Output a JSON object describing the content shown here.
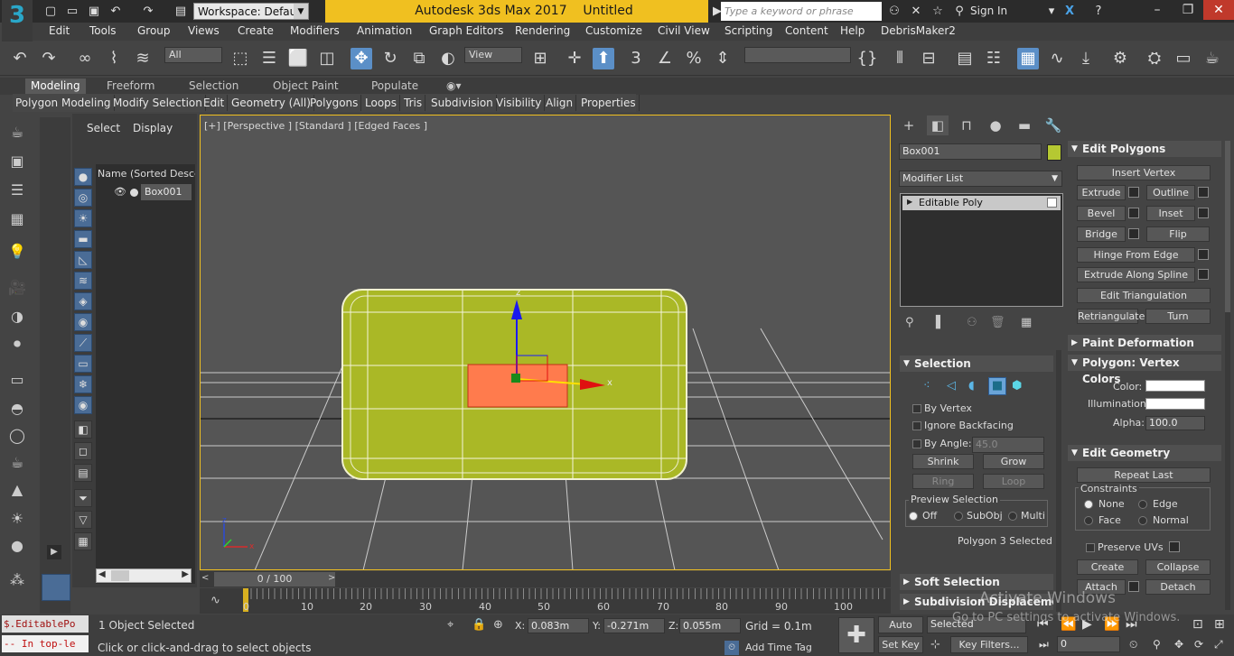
{
  "title_bar": {
    "logo": "3",
    "workspace": "Workspace: Default",
    "app_title": "Autodesk 3ds Max 2017",
    "doc_title": "Untitled",
    "search_placeholder": "Type a keyword or phrase",
    "sign_in": "Sign In"
  },
  "menu": [
    "Edit",
    "Tools",
    "Group",
    "Views",
    "Create",
    "Modifiers",
    "Animation",
    "Graph Editors",
    "Rendering",
    "Customize",
    "Civil View",
    "Scripting",
    "Content",
    "Help",
    "DebrisMaker2"
  ],
  "toolbar": {
    "filter_all": "All",
    "ref_coord": "View"
  },
  "ribbon": {
    "tabs": [
      "Modeling",
      "Freeform",
      "Selection",
      "Object Paint",
      "Populate"
    ],
    "buttons": [
      "Polygon Modeling",
      "Modify Selection",
      "Edit",
      "Geometry (All)",
      "Polygons",
      "Loops",
      "Tris",
      "Subdivision",
      "Visibility",
      "Align",
      "Properties"
    ]
  },
  "explorer": {
    "tab_select": "Select",
    "tab_display": "Display",
    "column_header": "Name (Sorted Descen",
    "item": "Box001"
  },
  "viewport": {
    "label": "[+] [Perspective ] [Standard ] [Edged Faces ]",
    "axis_z": "z",
    "axis_x": "x"
  },
  "timeline": {
    "frame": "0 / 100",
    "ticks": [
      "0",
      "10",
      "20",
      "30",
      "40",
      "50",
      "60",
      "70",
      "80",
      "90",
      "100"
    ]
  },
  "command_panel": {
    "object_name": "Box001",
    "object_color": "#b5c832",
    "modifier_list": "Modifier List",
    "stack_item": "Editable Poly",
    "selection": {
      "title": "Selection",
      "by_vertex": "By Vertex",
      "ignore_backfacing": "Ignore Backfacing",
      "by_angle": "By Angle:",
      "angle_value": "45.0",
      "shrink": "Shrink",
      "grow": "Grow",
      "ring": "Ring",
      "loop": "Loop",
      "preview_selection": "Preview Selection",
      "off": "Off",
      "subobj": "SubObj",
      "multi": "Multi",
      "status": "Polygon 3 Selected"
    },
    "soft_selection": "Soft Selection",
    "subdivision_displacement": "Subdivision Displacemer",
    "edit_polygons": {
      "title": "Edit Polygons",
      "insert_vertex": "Insert Vertex",
      "extrude": "Extrude",
      "outline": "Outline",
      "bevel": "Bevel",
      "inset": "Inset",
      "bridge": "Bridge",
      "flip": "Flip",
      "hinge_from_edge": "Hinge From Edge",
      "extrude_along_spline": "Extrude Along Spline",
      "edit_triangulation": "Edit Triangulation",
      "retriangulate": "Retriangulate",
      "turn": "Turn"
    },
    "paint_deformation": "Paint Deformation",
    "vertex_colors": {
      "title": "Polygon: Vertex Colors",
      "color": "Color:",
      "illumination": "Illumination:",
      "alpha": "Alpha:",
      "alpha_value": "100.0"
    },
    "edit_geometry": {
      "title": "Edit Geometry",
      "repeat_last": "Repeat Last",
      "constraints": "Constraints",
      "none": "None",
      "edge": "Edge",
      "face": "Face",
      "normal": "Normal",
      "preserve_uvs": "Preserve UVs",
      "create": "Create",
      "collapse": "Collapse",
      "attach": "Attach",
      "detach": "Detach"
    }
  },
  "status": {
    "maxscript_1": "$.EditablePo",
    "maxscript_2": "-- In top-le",
    "objects_selected": "1 Object Selected",
    "prompt": "Click or click-and-drag to select objects",
    "x_label": "X:",
    "x_value": "0.083m",
    "y_label": "Y:",
    "y_value": "-0.271m",
    "z_label": "Z:",
    "z_value": "0.055m",
    "grid": "Grid = 0.1m",
    "add_time_tag": "Add Time Tag",
    "auto_key": "Auto Key",
    "set_key": "Set Key",
    "selected": "Selected",
    "key_filters": "Key Filters...",
    "frame_value": "0"
  },
  "watermark": {
    "line1": "Activate Windows",
    "line2": "Go to PC settings to activate Windows."
  }
}
